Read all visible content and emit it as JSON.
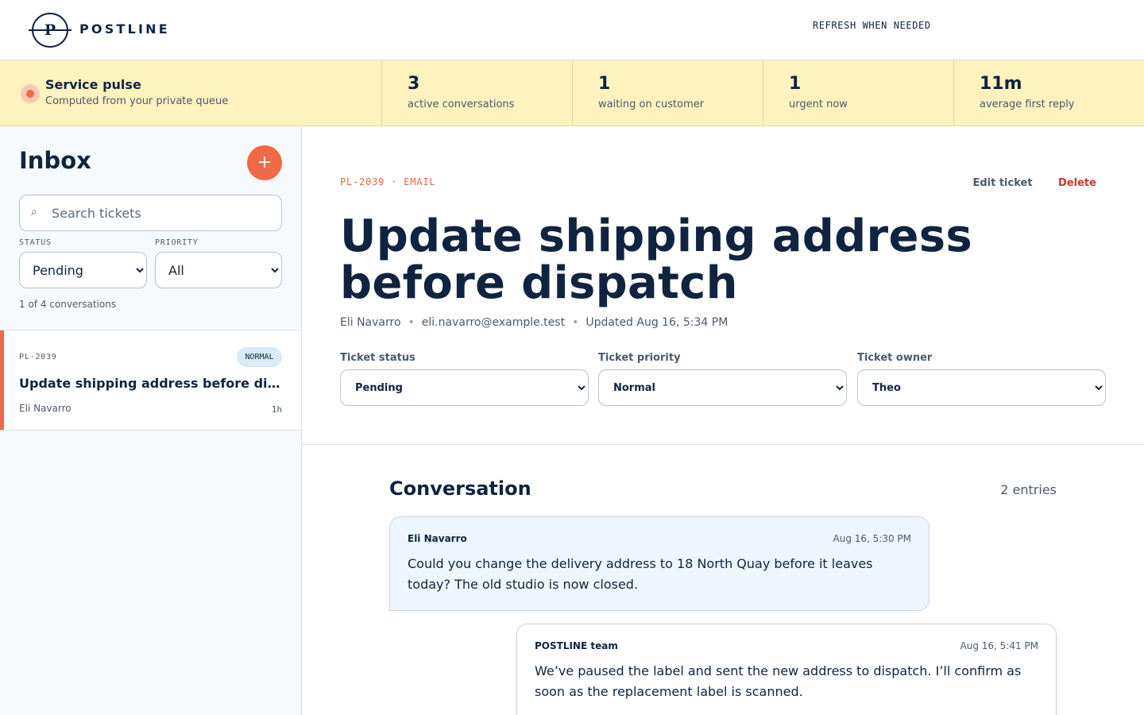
{
  "header": {
    "brand": "POSTLINE",
    "logo_letter": "P",
    "refresh_label": "REFRESH WHEN NEEDED"
  },
  "pulse": {
    "title": "Service pulse",
    "subtitle": "Computed from your private queue",
    "stats": [
      {
        "value": "3",
        "label": "active conversations"
      },
      {
        "value": "1",
        "label": "waiting on customer"
      },
      {
        "value": "1",
        "label": "urgent now"
      },
      {
        "value": "11m",
        "label": "average first reply"
      }
    ]
  },
  "sidebar": {
    "title": "Inbox",
    "add_label": "+",
    "search": {
      "placeholder": "Search tickets",
      "value": "",
      "icon": "search-icon"
    },
    "filters": {
      "status_label": "STATUS",
      "status_value": "Pending",
      "priority_label": "PRIORITY",
      "priority_value": "All"
    },
    "count_text": "1 of 4 conversations",
    "tickets": [
      {
        "id": "PL-2039",
        "badge": "NORMAL",
        "title": "Update shipping address before dispatch",
        "customer": "Eli Navarro",
        "age": "1h"
      }
    ]
  },
  "ticket": {
    "meta": "PL-2039 · EMAIL",
    "edit_label": "Edit ticket",
    "delete_label": "Delete",
    "title": "Update shipping address before dispatch",
    "customer_name": "Eli Navarro",
    "customer_email": "eli.navarro@example.test",
    "updated": "Updated Aug 16, 5:34 PM",
    "controls": {
      "status_label": "Ticket status",
      "status_value": "Pending",
      "priority_label": "Ticket priority",
      "priority_value": "Normal",
      "owner_label": "Ticket owner",
      "owner_value": "Theo"
    }
  },
  "conversation": {
    "title": "Conversation",
    "entries": "2 entries",
    "messages": [
      {
        "author": "Eli Navarro",
        "time": "Aug 16, 5:30 PM",
        "body": "Could you change the delivery address to 18 North Quay before it leaves today? The old studio is now closed."
      },
      {
        "author": "POSTLINE team",
        "time": "Aug 16, 5:41 PM",
        "body": "We’ve paused the label and sent the new address to dispatch. I’ll confirm as soon as the replacement label is scanned."
      }
    ]
  },
  "colors": {
    "accent": "#ef6a46",
    "ink": "#10243f",
    "pulse_bg": "#fef2bf",
    "danger": "#c0392b",
    "badge_bg": "#dbeaf8"
  }
}
